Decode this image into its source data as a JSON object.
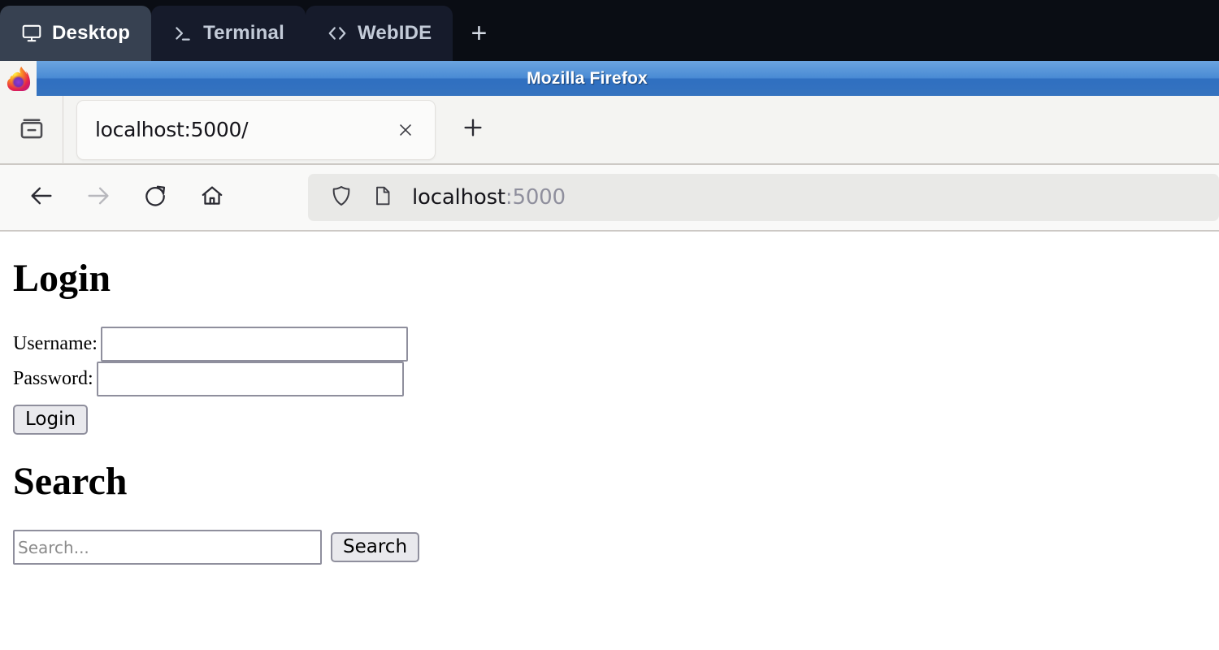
{
  "env_tabs": {
    "items": [
      {
        "label": "Desktop",
        "icon": "monitor-icon",
        "active": true
      },
      {
        "label": "Terminal",
        "icon": "terminal-icon",
        "active": false
      },
      {
        "label": "WebIDE",
        "icon": "code-icon",
        "active": false
      }
    ],
    "add_label": "+",
    "active_bg": "#374151",
    "inactive_bg": "#161b2b",
    "strip_bg": "#0a0d14"
  },
  "browser": {
    "window_title": "Mozilla Firefox",
    "titlebar_accent": "#3573bf",
    "tab": {
      "title": "localhost:5000/",
      "close_label": "×"
    },
    "new_tab_label": "+",
    "nav": {
      "back_label": "←",
      "forward_label": "→",
      "reload_label": "↻",
      "home_label": "⌂"
    },
    "urlbar": {
      "host": "localhost",
      "port": ":5000",
      "shield_icon": "shield-icon",
      "page_icon": "page-icon"
    }
  },
  "page": {
    "login": {
      "heading": "Login",
      "username_label": "Username:",
      "username_value": "",
      "password_label": "Password:",
      "password_value": "",
      "submit_label": "Login"
    },
    "search": {
      "heading": "Search",
      "input_value": "",
      "input_placeholder": "Search...",
      "submit_label": "Search"
    }
  }
}
